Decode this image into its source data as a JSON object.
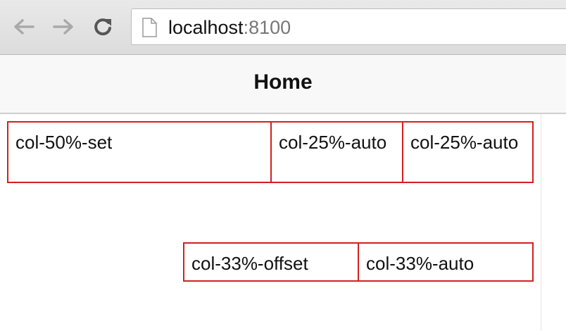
{
  "browser": {
    "address_host": "localhost",
    "address_port": ":8100"
  },
  "header": {
    "title": "Home"
  },
  "grid": {
    "row1": [
      "col-50%-set",
      "col-25%-auto",
      "col-25%-auto"
    ],
    "row2": [
      "col-33%-offset",
      "col-33%-auto"
    ]
  }
}
